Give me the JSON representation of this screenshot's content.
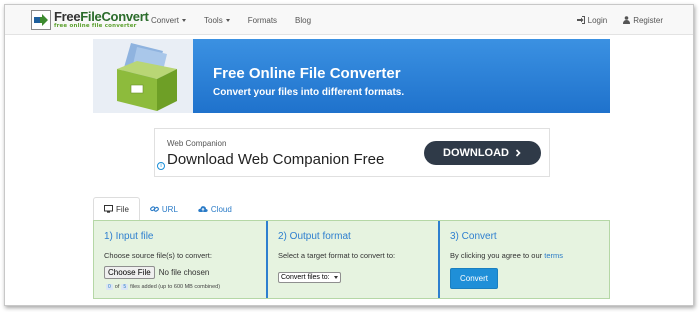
{
  "brand": {
    "name_prefix": "Free",
    "name_suffix": "FileConvert",
    "tagline": "free online file converter",
    "accent": "#2b6c2b"
  },
  "nav": {
    "items": [
      {
        "label": "Convert",
        "dropdown": true
      },
      {
        "label": "Tools",
        "dropdown": true
      },
      {
        "label": "Formats",
        "dropdown": false
      },
      {
        "label": "Blog",
        "dropdown": false
      }
    ],
    "login": "Login",
    "register": "Register"
  },
  "banner": {
    "title": "Free Online File Converter",
    "subtitle": "Convert your files into different formats."
  },
  "ad": {
    "small": "Web Companion",
    "headline": "Download Web Companion Free",
    "button": "DOWNLOAD",
    "info": "i"
  },
  "tabs": [
    {
      "label": "File",
      "icon": "monitor-icon"
    },
    {
      "label": "URL",
      "icon": "link-icon"
    },
    {
      "label": "Cloud",
      "icon": "cloud-icon"
    }
  ],
  "steps": {
    "input": {
      "title": "1) Input file",
      "instruction": "Choose source file(s) to convert:",
      "button": "Choose File",
      "file_status": "No file chosen",
      "count_current": "0",
      "count_of": "of",
      "count_max": "5",
      "limit_text": "files added (up to 600 MB combined)"
    },
    "output": {
      "title": "2) Output format",
      "instruction": "Select a target format to convert to:",
      "select_value": "Convert files to:"
    },
    "convert": {
      "title": "3) Convert",
      "agree_text": "By clicking you agree to our",
      "terms_link": "terms",
      "button": "Convert"
    }
  },
  "colors": {
    "banner": "#2d84d9",
    "panel_bg": "#e6f3e0",
    "step_title": "#2e7fcf",
    "convert_button": "#1f8fd8",
    "ad_button": "#2f3a48"
  }
}
